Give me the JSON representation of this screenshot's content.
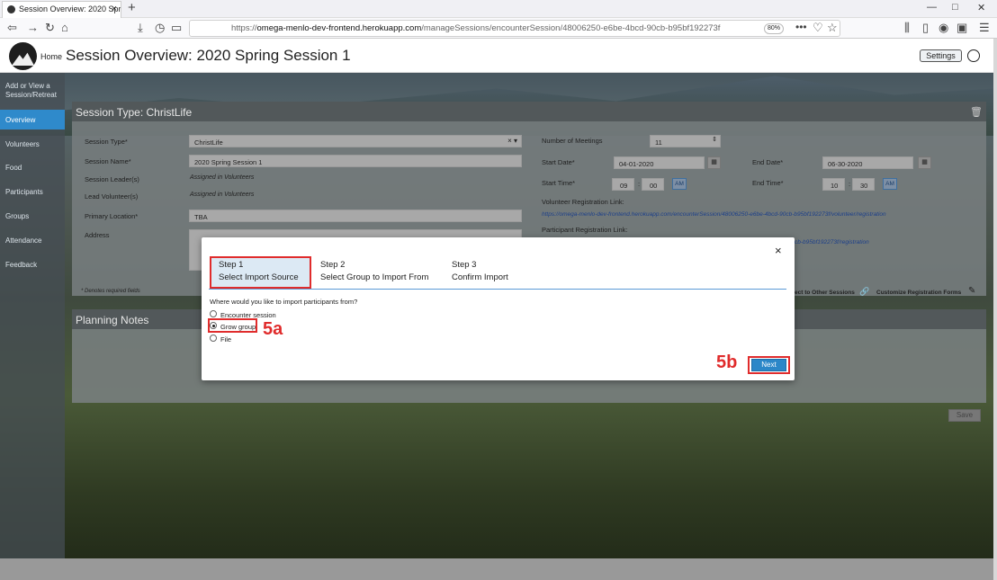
{
  "browser": {
    "tab_title": "Session Overview: 2020 Spring",
    "url_prefix": "https://",
    "url_host": "omega-menlo-dev-frontend.herokuapp.com",
    "url_path": "/manageSessions/encounterSession/48006250-e6be-4bcd-90cb-b95bf192273f",
    "zoom": "80%"
  },
  "header": {
    "home_label": "Home",
    "title": "Session Overview: 2020 Spring Session 1",
    "settings_label": "Settings"
  },
  "sidebar": {
    "items": [
      "Add or View a Session/Retreat",
      "Overview",
      "Volunteers",
      "Food",
      "Participants",
      "Groups",
      "Attendance",
      "Feedback"
    ],
    "active": "Overview"
  },
  "session": {
    "card_title": "Session Type: ChristLife",
    "session_type_label": "Session Type*",
    "session_type_value": "ChristLife",
    "session_name_label": "Session Name*",
    "session_name_value": "2020 Spring Session 1",
    "leaders_label": "Session Leader(s)",
    "leaders_value": "Assigned in Volunteers",
    "lead_volunteer_label": "Lead Volunteer(s)",
    "lead_volunteer_value": "Assigned in Volunteers",
    "location_label": "Primary Location*",
    "location_value": "TBA",
    "address_label": "Address",
    "meetings_label": "Number of Meetings",
    "meetings_value": "11",
    "start_date_label": "Start Date*",
    "start_date_value": "04-01-2020",
    "end_date_label": "End Date*",
    "end_date_value": "06-30-2020",
    "start_time_label": "Start Time*",
    "start_hour": "09",
    "start_min": "00",
    "start_ampm": "AM",
    "end_time_label": "End Time*",
    "end_hour": "10",
    "end_min": "30",
    "end_ampm": "AM",
    "vol_reg_label": "Volunteer Registration Link:",
    "vol_reg_link": "https://omega-menlo-dev-frontend.herokuapp.com/encounterSession/48006250-e6be-4bcd-90cb-b95bf192273f/volunteer/registration",
    "part_reg_label": "Participant Registration Link:",
    "part_reg_link_tail": "cb-b95bf192273f/registration",
    "required_note": "* Denotes required fields",
    "connect_label": "ect to Other Sessions",
    "customize_label": "Customize Registration Forms"
  },
  "notes": {
    "title": "Planning Notes",
    "save_label": "Save"
  },
  "modal": {
    "steps": [
      {
        "num": "Step 1",
        "label": "Select Import Source"
      },
      {
        "num": "Step 2",
        "label": "Select Group to Import From"
      },
      {
        "num": "Step 3",
        "label": "Confirm Import"
      }
    ],
    "question": "Where would you like to import participants from?",
    "options": [
      "Encounter session",
      "Grow group",
      "File"
    ],
    "selected": "Grow group",
    "next_label": "Next",
    "close_icon": "×"
  },
  "annotations": {
    "a": "5a",
    "b": "5b"
  },
  "colors": {
    "accent": "#2b87c8",
    "highlight": "#e02c2c"
  }
}
